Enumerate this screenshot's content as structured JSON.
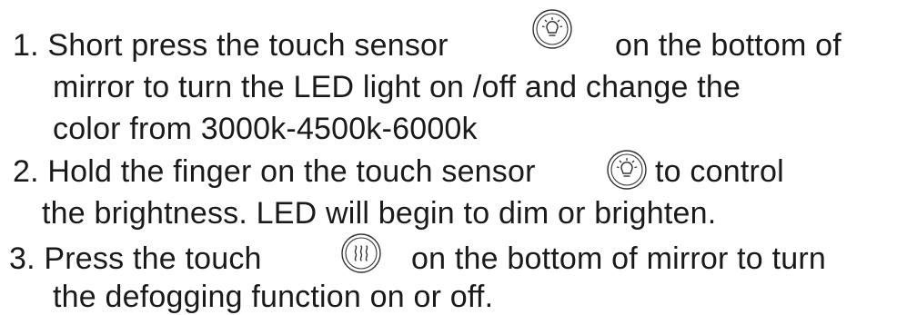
{
  "instructions": {
    "step1": {
      "part1": "1. Short press the touch sensor",
      "part2": "on the bottom of",
      "line2": "mirror to turn the LED  light on /off and change the",
      "line3": "color from 3000k-4500k-6000k",
      "icon": "light-bulb-icon"
    },
    "step2": {
      "part1": "2. Hold the finger on the touch sensor",
      "part2": "to control",
      "line2": "the brightness. LED will begin to dim or brighten.",
      "icon": "light-bulb-icon"
    },
    "step3": {
      "part1": "3. Press the touch",
      "part2": "on the bottom of mirror to turn",
      "line2": "the defogging  function on or off.",
      "icon": "defog-heat-icon"
    }
  }
}
